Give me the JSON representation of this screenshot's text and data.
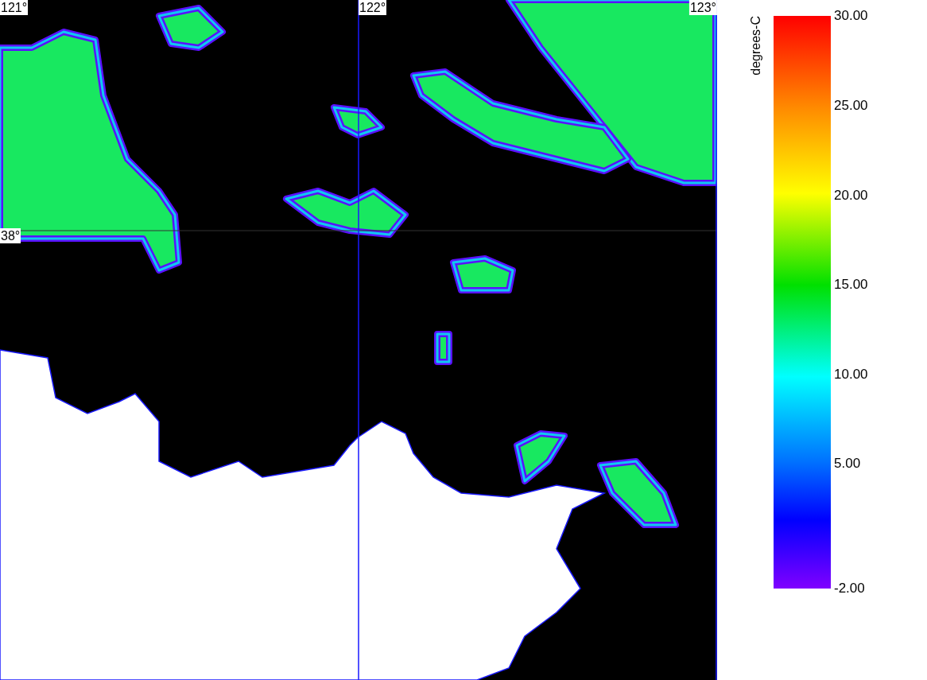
{
  "map": {
    "longitude_labels": [
      "121°",
      "122°",
      "123°"
    ],
    "latitude_labels": [
      "38°"
    ]
  },
  "colorbar": {
    "unit": "degrees-C",
    "ticks": [
      {
        "label": "30.00"
      },
      {
        "label": "25.00"
      },
      {
        "label": "20.00"
      },
      {
        "label": "15.00"
      },
      {
        "label": "10.00"
      },
      {
        "label": "5.00"
      },
      {
        "label": "-2.00"
      }
    ]
  }
}
